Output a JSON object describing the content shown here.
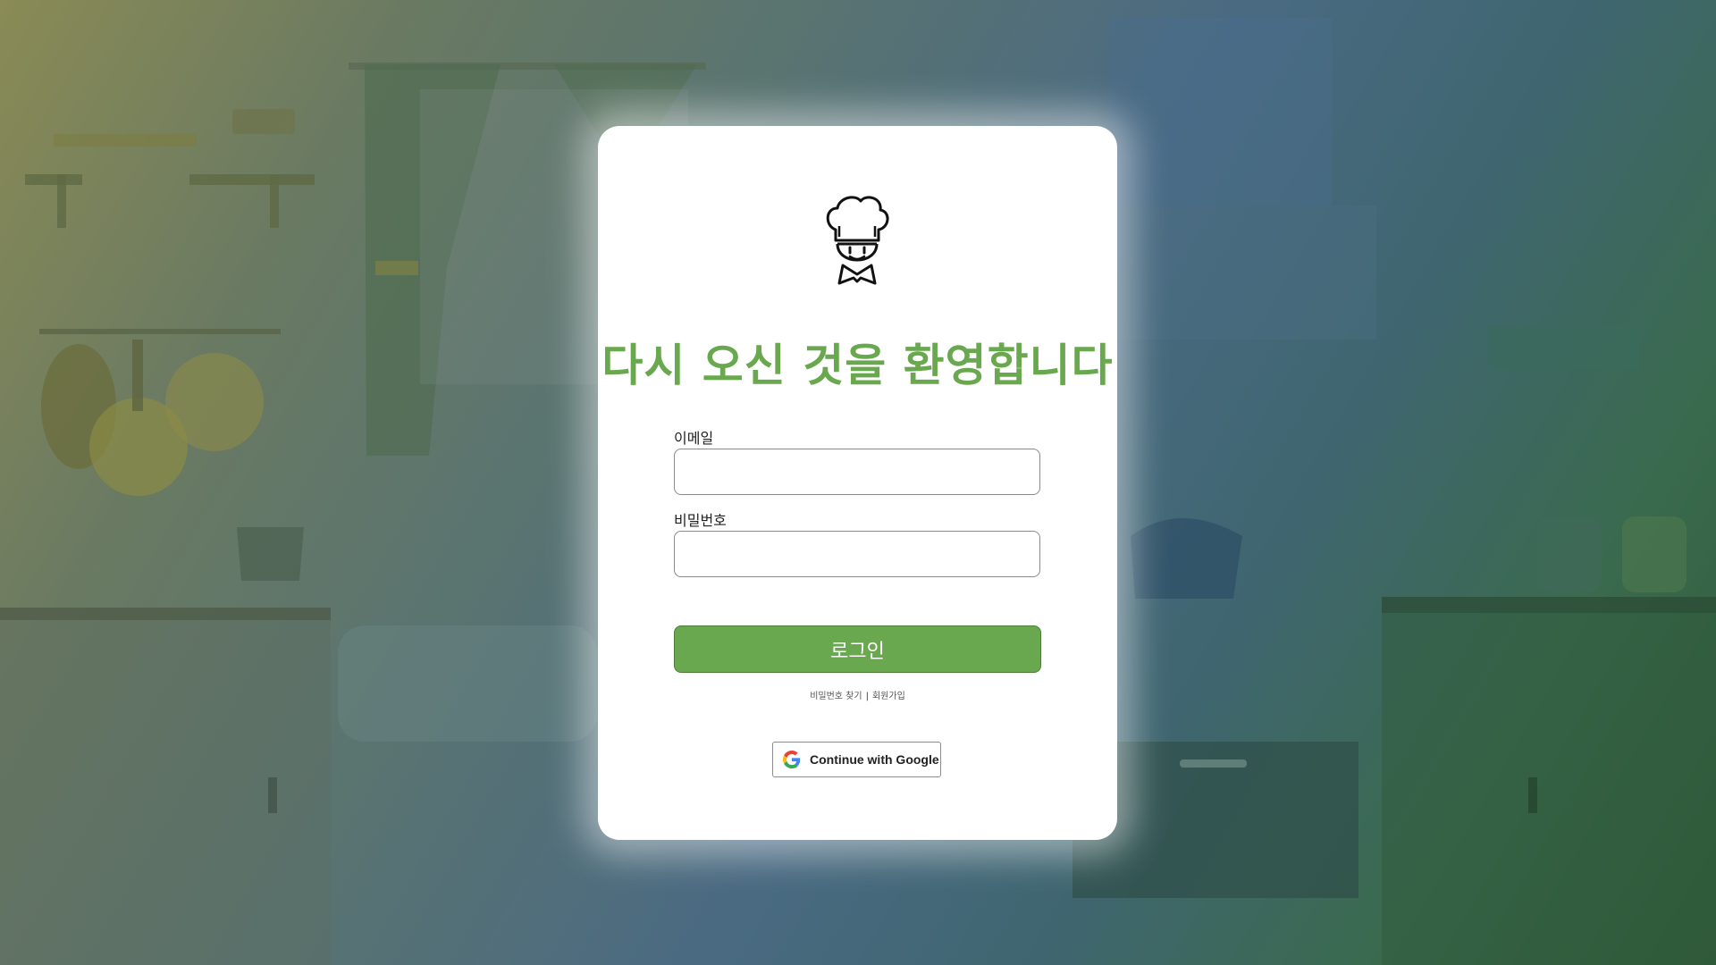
{
  "login": {
    "title": "다시 오신 것을 환영합니다",
    "email_label": "이메일",
    "email_value": "",
    "password_label": "비밀번호",
    "password_value": "",
    "login_button": "로그인",
    "find_password_link": "비밀번호 찾기",
    "separator": "|",
    "signup_link": "회원가입",
    "google_button": "Continue with Google"
  },
  "colors": {
    "accent": "#6aa84f",
    "card_background": "#ffffff"
  },
  "icons": {
    "logo": "chef-icon",
    "google": "google-icon"
  }
}
